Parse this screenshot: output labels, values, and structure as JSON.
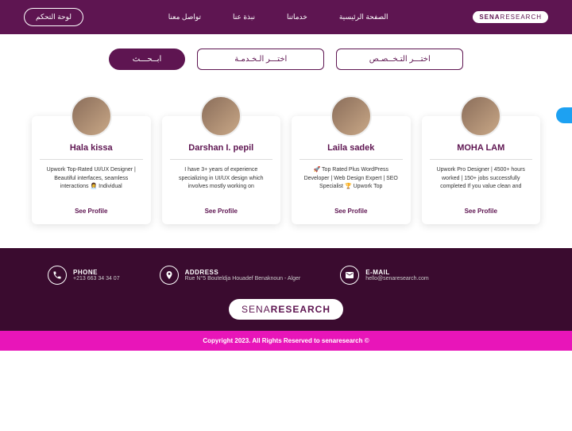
{
  "header": {
    "logo_left": "SENA",
    "logo_right": "RESEARCH",
    "nav": [
      "الصفحة الرئيسية",
      "خدماتنا",
      "نبذة عنا",
      "تواصل معنا"
    ],
    "dashboard": "لوحة التحكم"
  },
  "search": {
    "specialty": "اختـــر التـخــصـص",
    "service": "اختـــر الـخـدمـة",
    "button": "ابــحـــث"
  },
  "profiles": [
    {
      "name": "Hala kissa",
      "desc": "Upwork Top-Rated UI/UX Designer | Beautiful interfaces, seamless interactions 👩‍💼 Individual",
      "see": "See Profile"
    },
    {
      "name": "Darshan I. pepil",
      "desc": "I have 3+ years of experience specializing in UI/UX design which involves mostly working on",
      "see": "See Profile"
    },
    {
      "name": "Laila sadek",
      "desc": "🚀 Top Rated Plus WordPress Developer | Web Design Expert | SEO Specialist 🏆 Upwork Top",
      "see": "See Profile"
    },
    {
      "name": "MOHA LAM",
      "desc": "Upwork Pro Designer | 4500+ hours worked | 150+ jobs successfully completed If you value clean and",
      "see": "See Profile"
    }
  ],
  "footer": {
    "phone_label": "PHONE",
    "phone": "+213 663 34 34 07",
    "address_label": "ADDRESS",
    "address": "Rue N°5 Bouteldja Houadef Benaknoun - Alger",
    "email_label": "E-MAIL",
    "email": "hello@senaresearch.com",
    "logo_left": "SENA",
    "logo_right": "RESEARCH",
    "copyright": "© Copyright 2023. All Rights Reserved to senaresearch"
  }
}
